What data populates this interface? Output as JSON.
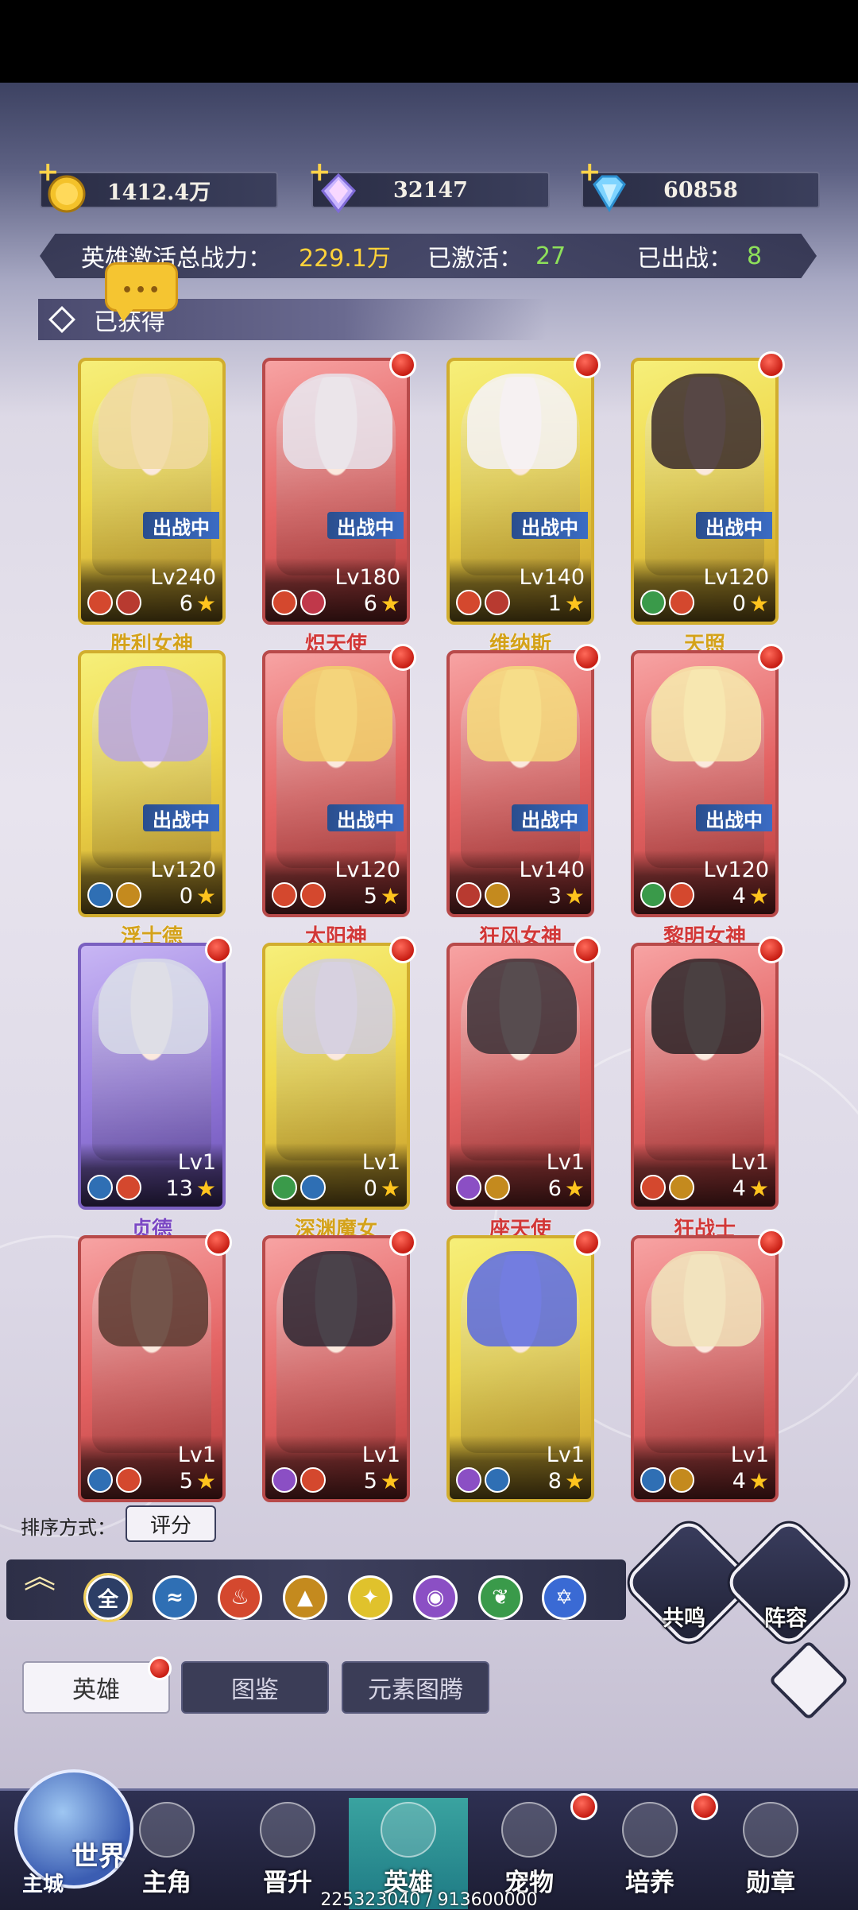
{
  "currencies": [
    {
      "id": "gold",
      "value": "1412.4万",
      "icon": "gold-coin-icon",
      "color": "#f4c22a"
    },
    {
      "id": "crystal",
      "value": "32147",
      "icon": "rainbow-crystal-icon",
      "color": "#c9b5ff"
    },
    {
      "id": "diamond",
      "value": "60858",
      "icon": "blue-diamond-icon",
      "color": "#7ed4ff"
    }
  ],
  "power": {
    "label": "英雄激活总战力：",
    "value": "229.1万",
    "activated_label": "已激活：",
    "activated_value": "27",
    "deployed_label": "已出战：",
    "deployed_value": "8"
  },
  "section": {
    "title": "已获得"
  },
  "chat": {
    "dots": "•••"
  },
  "heroes": [
    {
      "name": "胜利女神",
      "level": "Lv240",
      "stars": "6",
      "badge": "出战中",
      "frame": "gold",
      "new": false
    },
    {
      "name": "炽天使",
      "level": "Lv180",
      "stars": "6",
      "badge": "出战中",
      "frame": "red",
      "new": true
    },
    {
      "name": "维纳斯",
      "level": "Lv140",
      "stars": "1",
      "badge": "出战中",
      "frame": "gold",
      "new": true
    },
    {
      "name": "天照",
      "level": "Lv120",
      "stars": "0",
      "badge": "出战中",
      "frame": "gold",
      "new": true
    },
    {
      "name": "浮士德",
      "level": "Lv120",
      "stars": "0",
      "badge": "出战中",
      "frame": "gold",
      "new": false
    },
    {
      "name": "太阳神",
      "level": "Lv120",
      "stars": "5",
      "badge": "出战中",
      "frame": "red",
      "new": true
    },
    {
      "name": "狂风女神",
      "level": "Lv140",
      "stars": "3",
      "badge": "出战中",
      "frame": "red",
      "new": true
    },
    {
      "name": "黎明女神",
      "level": "Lv120",
      "stars": "4",
      "badge": "出战中",
      "frame": "red",
      "new": true
    },
    {
      "name": "贞德",
      "level": "Lv1",
      "stars": "13",
      "badge": "",
      "frame": "purple",
      "new": true
    },
    {
      "name": "深渊魔女",
      "level": "Lv1",
      "stars": "0",
      "badge": "",
      "frame": "gold",
      "new": true
    },
    {
      "name": "座天使",
      "level": "Lv1",
      "stars": "6",
      "badge": "",
      "frame": "red",
      "new": true
    },
    {
      "name": "狂战士",
      "level": "Lv1",
      "stars": "4",
      "badge": "",
      "frame": "red",
      "new": true
    },
    {
      "name": "",
      "level": "Lv1",
      "stars": "5",
      "badge": "",
      "frame": "red",
      "new": true
    },
    {
      "name": "",
      "level": "Lv1",
      "stars": "5",
      "badge": "",
      "frame": "red",
      "new": true
    },
    {
      "name": "",
      "level": "Lv1",
      "stars": "8",
      "badge": "",
      "frame": "gold",
      "new": true
    },
    {
      "name": "",
      "level": "Lv1",
      "stars": "4",
      "badge": "",
      "frame": "red",
      "new": true
    }
  ],
  "sort": {
    "label": "排序方式：",
    "value": "评分"
  },
  "filters": {
    "all_label": "全",
    "elements": [
      "water-wave-icon",
      "fire-icon",
      "earth-icon",
      "light-icon",
      "eye-icon",
      "leaf-icon",
      "star-of-david-icon"
    ]
  },
  "actions": {
    "resonance": "共鸣",
    "lineup": "阵容"
  },
  "tabs": [
    {
      "label": "英雄",
      "active": true
    },
    {
      "label": "图鉴",
      "active": false
    },
    {
      "label": "元素图腾",
      "active": false
    }
  ],
  "world": {
    "label": "世界",
    "sublabel": "主城"
  },
  "nav": [
    {
      "label": "主角",
      "active": false,
      "dot": false
    },
    {
      "label": "晋升",
      "active": false,
      "dot": false
    },
    {
      "label": "英雄",
      "active": true,
      "dot": false
    },
    {
      "label": "宠物",
      "active": false,
      "dot": true
    },
    {
      "label": "培养",
      "active": false,
      "dot": true
    },
    {
      "label": "勋章",
      "active": false,
      "dot": false
    }
  ],
  "footer": {
    "text": "225323040 / 913600000"
  },
  "colors": {
    "gold_name": "#d4a21a",
    "red_name": "#d23838",
    "purple_name": "#7b48c4",
    "active_tab": "#3aa3a0",
    "green_value": "#8ee05a",
    "yellow_value": "#ffd23a"
  }
}
